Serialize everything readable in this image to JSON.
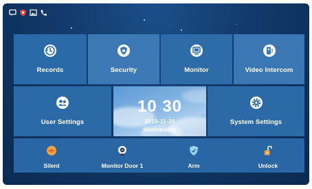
{
  "status_icons": [
    "message-icon",
    "security-icon",
    "picture-icon",
    "phone-icon"
  ],
  "tiles": {
    "records": {
      "label": "Records",
      "icon": "history-icon"
    },
    "security": {
      "label": "Security",
      "icon": "shield-icon"
    },
    "monitor": {
      "label": "Monitor",
      "icon": "monitor-icon"
    },
    "video_intercom": {
      "label": "Video Intercom",
      "icon": "intercom-icon"
    },
    "user_settings": {
      "label": "User Settings",
      "icon": "users-icon"
    },
    "system_settings": {
      "label": "System Settings",
      "icon": "gear-icon"
    }
  },
  "clock": {
    "time": "10 30",
    "date": "2019-11-20",
    "weekday": "Wednesday"
  },
  "quick_actions": [
    {
      "label": "Silent",
      "icon": "silent-icon"
    },
    {
      "label": "Monitor Door 1",
      "icon": "door-camera-icon"
    },
    {
      "label": "Arm",
      "icon": "arm-shield-icon"
    },
    {
      "label": "Unlock",
      "icon": "unlock-icon"
    }
  ],
  "colors": {
    "accent_orange": "#f0a23a",
    "tile_blue": "#2b6aa8"
  }
}
